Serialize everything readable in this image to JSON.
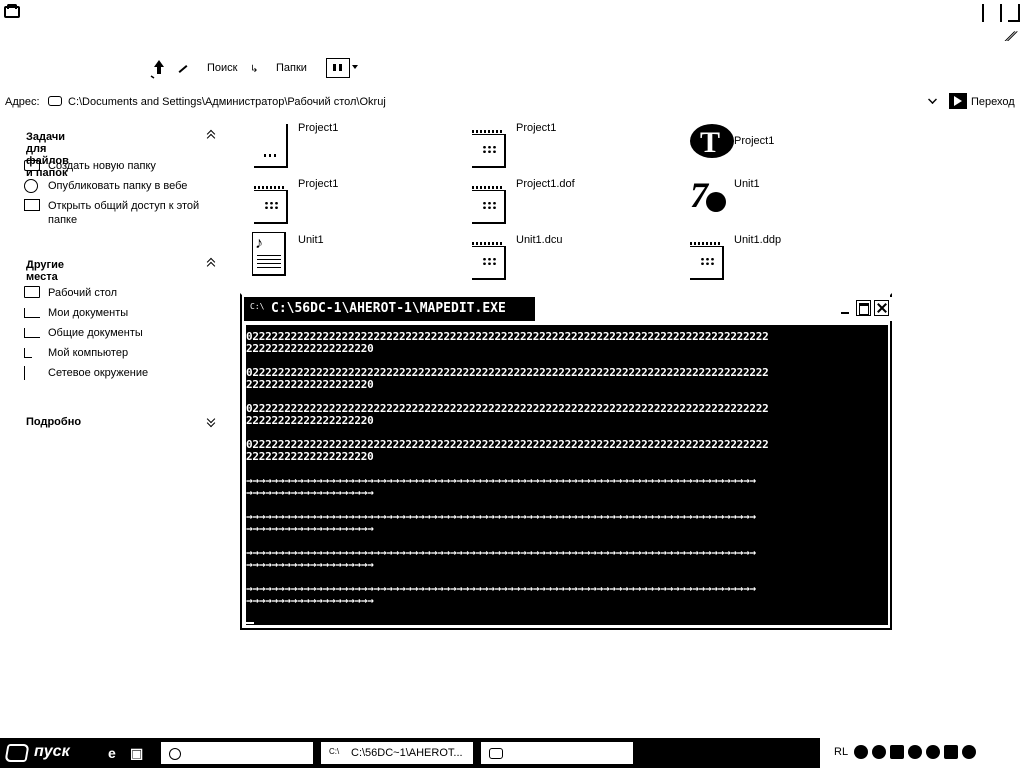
{
  "toolbar": {
    "search_label": "Поиск",
    "folders_label": "Папки",
    "back_arrow_glyph": "↑",
    "folders_glyph": "↳"
  },
  "address": {
    "label": "Адрес:",
    "value": "C:\\Documents and Settings\\Администратор\\Рабочий стол\\Okruj",
    "go_label": "Переход"
  },
  "tasks": {
    "file_tasks": {
      "title": "Задачи для файлов и папок",
      "items": [
        "Создать новую папку",
        "Опубликовать папку в вебе",
        "Открыть общий доступ к этой папке"
      ]
    },
    "other_places": {
      "title": "Другие места",
      "items": [
        "Рабочий стол",
        "Мои документы",
        "Общие документы",
        "Мой компьютер",
        "Сетевое окружение"
      ]
    },
    "details": {
      "title": "Подробно"
    }
  },
  "files": [
    {
      "name": "Project1",
      "icon": "generic-file-icon"
    },
    {
      "name": "Project1",
      "icon": "config-file-icon"
    },
    {
      "name": "Project1",
      "icon": "delphi-project-icon"
    },
    {
      "name": "Project1",
      "icon": "config-file-icon"
    },
    {
      "name": "Project1.dof",
      "icon": "config-file-icon"
    },
    {
      "name": "Unit1",
      "icon": "delphi-unit-icon"
    },
    {
      "name": "Unit1",
      "icon": "text-document-icon"
    },
    {
      "name": "Unit1.dcu",
      "icon": "config-file-icon"
    },
    {
      "name": "Unit1.ddp",
      "icon": "config-file-icon"
    }
  ],
  "console": {
    "title": "C:\\56DC-1\\AHEROT-1\\MAPEDIT.EXE",
    "icon_glyph": "C:\\",
    "lines": [
      "0222222222222222222222222222222222222222222222222222222222222222222222222222222222",
      "22222222222222222220",
      "",
      "0222222222222222222222222222222222222222222222222222222222222222222222222222222222",
      "22222222222222222220",
      "",
      "0222222222222222222222222222222222222222222222222222222222222222222222222222222222",
      "22222222222222222220",
      "",
      "0222222222222222222222222222222222222222222222222222222222222222222222222222222222",
      "22222222222222222220",
      "",
      "→→→→→→→→→→→→→→→→→→→→→→→→→→→→→→→→→→→→→→→→→→→→→→→→→→→→→→→→→→→→→→→→→→→→→→→→→→→→→→→→",
      "→→→→→→→→→→→→→→→→→→→→",
      "",
      "→→→→→→→→→→→→→→→→→→→→→→→→→→→→→→→→→→→→→→→→→→→→→→→→→→→→→→→→→→→→→→→→→→→→→→→→→→→→→→→→",
      "→→→→→→→→→→→→→→→→→→→→",
      "",
      "→→→→→→→→→→→→→→→→→→→→→→→→→→→→→→→→→→→→→→→→→→→→→→→→→→→→→→→→→→→→→→→→→→→→→→→→→→→→→→→→",
      "→→→→→→→→→→→→→→→→→→→→",
      "",
      "→→→→→→→→→→→→→→→→→→→→→→→→→→→→→→→→→→→→→→→→→→→→→→→→→→→→→→→→→→→→→→→→→→→→→→→→→→→→→→→→",
      "→→→→→→→→→→→→→→→→→→→→"
    ]
  },
  "taskbar": {
    "start_label": "пуск",
    "buttons": [
      {
        "label": "",
        "icon": "search-icon"
      },
      {
        "label": "C:\\56DC~1\\AHEROT...",
        "icon": "console-icon"
      },
      {
        "label": "",
        "icon": "folder-icon"
      }
    ],
    "language": "RL"
  }
}
